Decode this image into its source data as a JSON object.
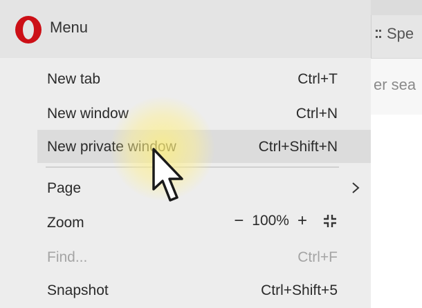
{
  "window": {
    "menu_title": "Menu",
    "logo_icon": "opera-logo-icon"
  },
  "browser": {
    "tab_label": "Spe",
    "address_text": "er sea"
  },
  "menu": {
    "items": [
      {
        "label": "New tab",
        "shortcut": "Ctrl+T",
        "enabled": true
      },
      {
        "label": "New window",
        "shortcut": "Ctrl+N",
        "enabled": true
      },
      {
        "label": "New private window",
        "shortcut": "Ctrl+Shift+N",
        "enabled": true,
        "highlighted": true
      },
      {
        "label": "Page",
        "submenu": true,
        "enabled": true
      },
      {
        "label": "Zoom",
        "enabled": true
      },
      {
        "label": "Find...",
        "shortcut": "Ctrl+F",
        "enabled": false
      },
      {
        "label": "Snapshot",
        "shortcut": "Ctrl+Shift+5",
        "enabled": true
      }
    ],
    "zoom": {
      "minus": "−",
      "value": "100%",
      "plus": "+",
      "fullscreen_icon": "fullscreen-icon"
    }
  },
  "colors": {
    "logo_red": "#cc0f16",
    "highlight": "#fff08a",
    "disabled_text": "#a4a4a4"
  }
}
